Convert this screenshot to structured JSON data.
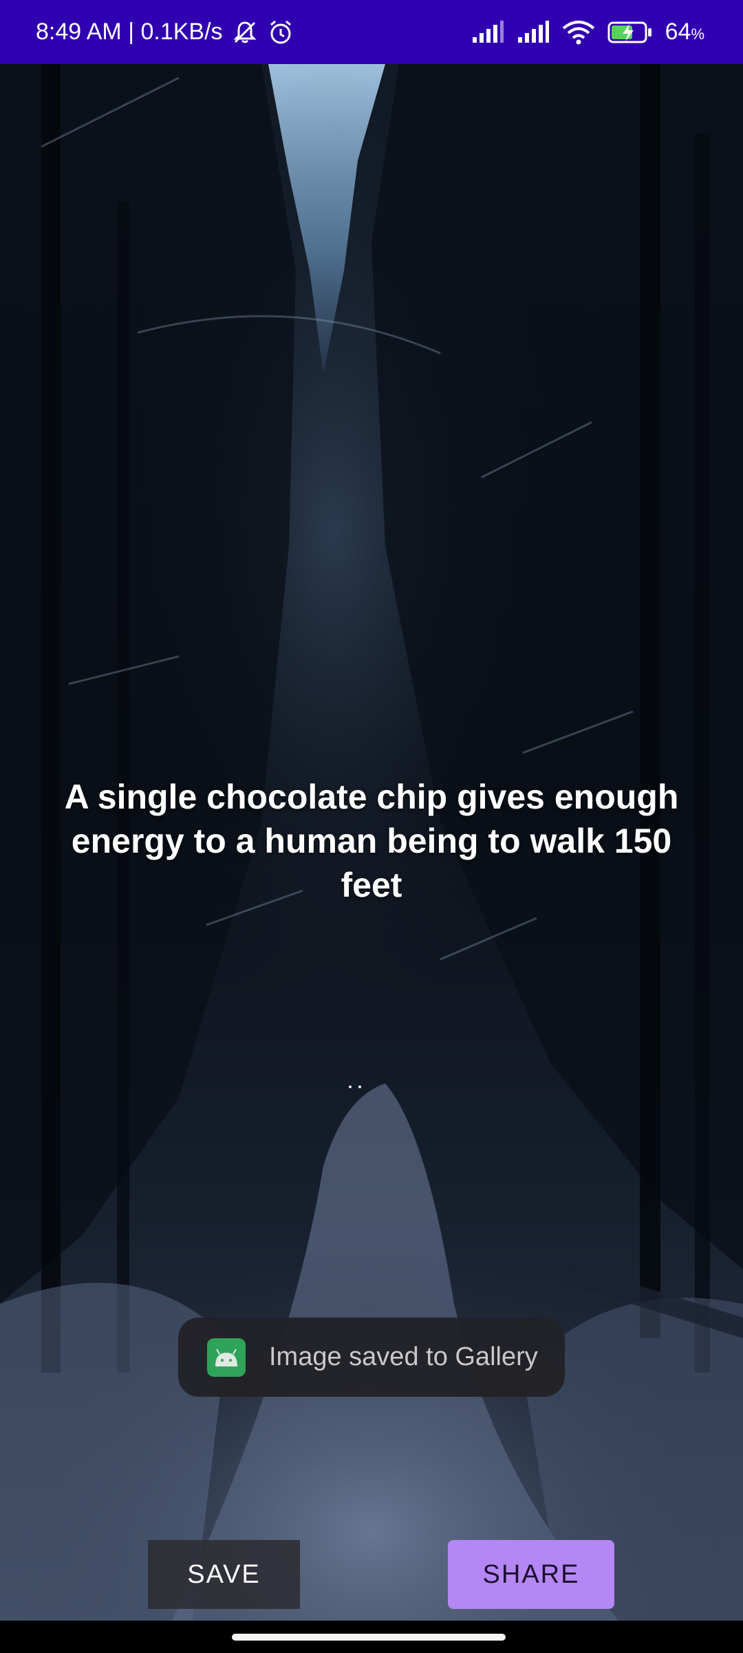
{
  "status_bar": {
    "time_speed": "8:49 AM | 0.1KB/s",
    "battery_percent": "64",
    "battery_unit": "%",
    "background_color": "#3000b0",
    "icons": [
      "mute-bell-icon",
      "alarm-icon",
      "signal-icon",
      "signal-icon",
      "wifi-icon",
      "battery-charging-icon"
    ]
  },
  "quote": {
    "text": "A single chocolate chip gives enough energy to a human being to walk 150 feet"
  },
  "toast": {
    "message": "Image saved to Gallery",
    "icon": "android-icon"
  },
  "actions": {
    "save_label": "SAVE",
    "share_label": "SHARE",
    "share_color": "#b587f5"
  }
}
